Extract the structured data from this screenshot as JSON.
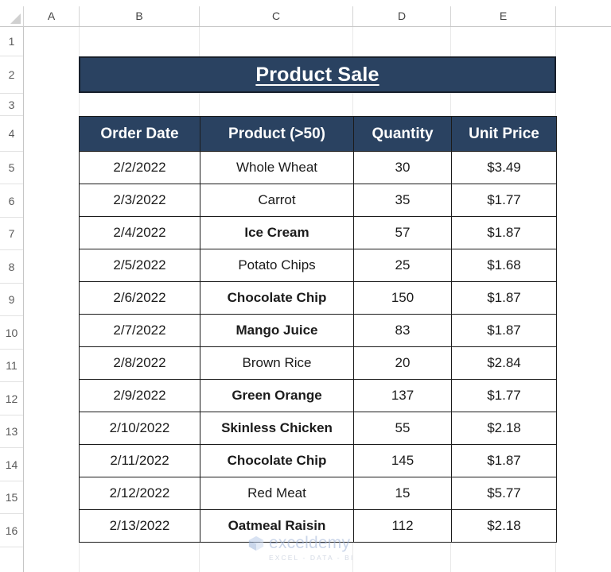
{
  "app": {
    "type": "spreadsheet",
    "accent_color": "#2A4261",
    "grid_line_color": "#D4D4D4",
    "header_text_color": "#FFFFFF"
  },
  "grid": {
    "column_headers": [
      "A",
      "B",
      "C",
      "D",
      "E"
    ],
    "row_headers": [
      "1",
      "2",
      "3",
      "4",
      "5",
      "6",
      "7",
      "8",
      "9",
      "10",
      "11",
      "12",
      "13",
      "14",
      "15",
      "16"
    ],
    "select_all_icon": "select-all-triangle-icon"
  },
  "table": {
    "title": "Product Sale",
    "columns": [
      "Order Date",
      "Product (>50)",
      "Quantity",
      "Unit Price"
    ],
    "rows": [
      {
        "order_date": "2/2/2022",
        "product": "Whole Wheat",
        "quantity": "30",
        "unit_price": "$3.49",
        "product_bold": false
      },
      {
        "order_date": "2/3/2022",
        "product": "Carrot",
        "quantity": "35",
        "unit_price": "$1.77",
        "product_bold": false
      },
      {
        "order_date": "2/4/2022",
        "product": "Ice Cream",
        "quantity": "57",
        "unit_price": "$1.87",
        "product_bold": true
      },
      {
        "order_date": "2/5/2022",
        "product": "Potato Chips",
        "quantity": "25",
        "unit_price": "$1.68",
        "product_bold": false
      },
      {
        "order_date": "2/6/2022",
        "product": "Chocolate Chip",
        "quantity": "150",
        "unit_price": "$1.87",
        "product_bold": true
      },
      {
        "order_date": "2/7/2022",
        "product": "Mango Juice",
        "quantity": "83",
        "unit_price": "$1.87",
        "product_bold": true
      },
      {
        "order_date": "2/8/2022",
        "product": "Brown Rice",
        "quantity": "20",
        "unit_price": "$2.84",
        "product_bold": false
      },
      {
        "order_date": "2/9/2022",
        "product": "Green Orange",
        "quantity": "137",
        "unit_price": "$1.77",
        "product_bold": true
      },
      {
        "order_date": "2/10/2022",
        "product": "Skinless Chicken",
        "quantity": "55",
        "unit_price": "$2.18",
        "product_bold": true
      },
      {
        "order_date": "2/11/2022",
        "product": "Chocolate Chip",
        "quantity": "145",
        "unit_price": "$1.87",
        "product_bold": true
      },
      {
        "order_date": "2/12/2022",
        "product": "Red Meat",
        "quantity": "15",
        "unit_price": "$5.77",
        "product_bold": false
      },
      {
        "order_date": "2/13/2022",
        "product": "Oatmeal Raisin",
        "quantity": "112",
        "unit_price": "$2.18",
        "product_bold": true
      }
    ]
  },
  "watermark": {
    "name": "exceldemy",
    "tagline": "EXCEL - DATA - BI",
    "logo_icon": "cube-logo-icon",
    "color": "#9FB4D8"
  }
}
